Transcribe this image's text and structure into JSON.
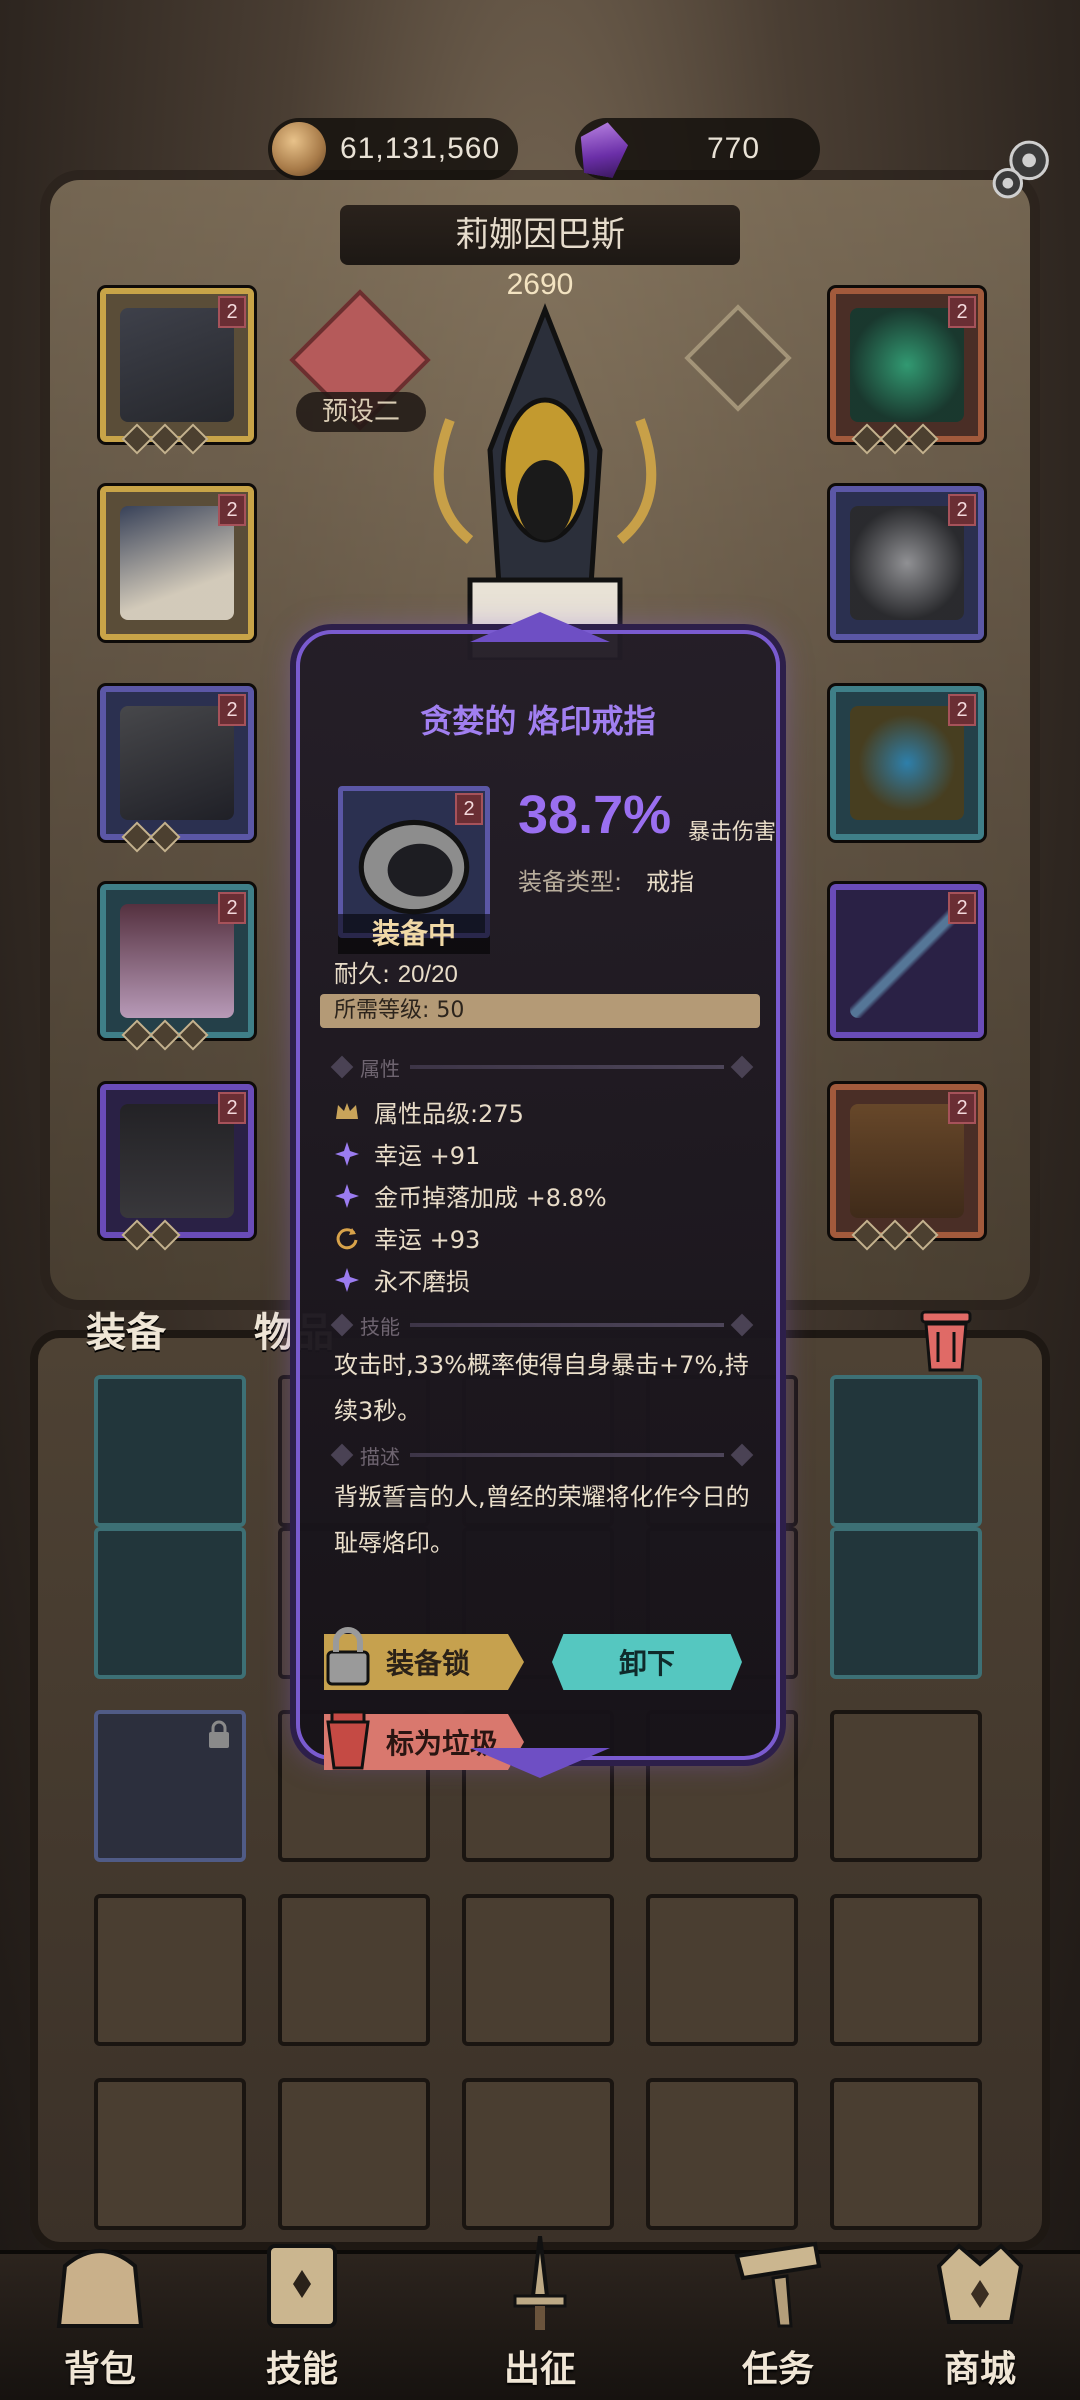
{
  "currency": {
    "gold": "61,131,560",
    "gems": "770"
  },
  "hero": {
    "name": "莉娜因巴斯",
    "power": "2690",
    "preset_label": "预设二"
  },
  "equip_slots": [
    {
      "level": "2"
    },
    {
      "level": "2"
    },
    {
      "level": "2"
    },
    {
      "level": "2"
    },
    {
      "level": "2"
    },
    {
      "level": "2"
    },
    {
      "level": "2"
    },
    {
      "level": "2"
    },
    {
      "level": "2"
    },
    {
      "level": "2"
    }
  ],
  "tabs": {
    "equipment": "装备",
    "items": "物品"
  },
  "item_popup": {
    "title": "贪婪的 烙印戒指",
    "level": "2",
    "equipped_label": "装备中",
    "main_stat": "38.7%",
    "main_stat_label": "暴击伤害",
    "type_label": "装备类型:",
    "type_value": "戒指",
    "durability_label": "耐久:",
    "durability_value": "20/20",
    "required_level_label": "所需等级:",
    "required_level_value": "50",
    "section_attributes": "属性",
    "attributes": [
      {
        "icon": "crown-icon",
        "text": "属性品级:275"
      },
      {
        "icon": "sparkle-icon",
        "text": "幸运 +91"
      },
      {
        "icon": "sparkle-icon",
        "text": "金币掉落加成 +8.8%"
      },
      {
        "icon": "reroll-icon",
        "text": "幸运 +93"
      },
      {
        "icon": "sparkle-icon",
        "text": "永不磨损"
      }
    ],
    "section_skill": "技能",
    "skill_text": "攻击时,33%概率使得自身暴击+7%,持续3秒。",
    "section_desc": "描述",
    "desc_text": "背叛誓言的人,曾经的荣耀将化作今日的耻辱烙印。",
    "btn_lock": "装备锁",
    "btn_unequip": "卸下",
    "btn_trash": "标为垃圾"
  },
  "nav": [
    "背包",
    "技能",
    "出征",
    "任务",
    "商城"
  ],
  "colors": {
    "accent_purple": "#9a6ff0",
    "popup_border": "#7a5bd0",
    "unequip_btn": "#55c7c0",
    "lock_btn": "#c6a14e",
    "trash_btn": "#d9786e"
  }
}
